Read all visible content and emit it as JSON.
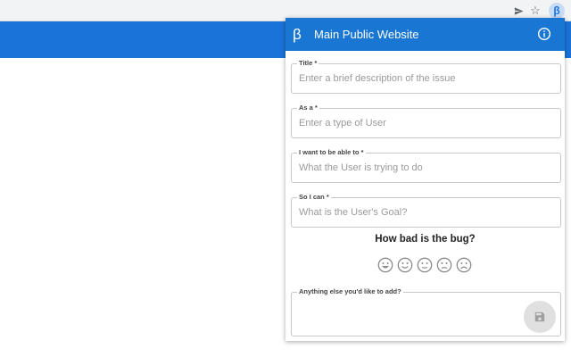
{
  "browser": {
    "send_icon": "send-icon",
    "star_icon": "star-icon",
    "extension_glyph": "β"
  },
  "popup": {
    "logo": "β",
    "title": "Main Public Website",
    "header_color": "#1976d2",
    "fields": [
      {
        "label": "Title *",
        "placeholder": "Enter a brief description of the issue"
      },
      {
        "label": "As a *",
        "placeholder": "Enter a type of User"
      },
      {
        "label": "I want to be able to *",
        "placeholder": "What the User is trying to do"
      },
      {
        "label": "So I can *",
        "placeholder": "What is the User's Goal?"
      }
    ],
    "rating_question": "How bad is the bug?",
    "rating_faces": [
      "very-happy-face-icon",
      "happy-face-icon",
      "neutral-face-icon",
      "slightly-sad-face-icon",
      "sad-face-icon"
    ],
    "extra": {
      "label": "Anything else you'd like to add?",
      "placeholder": ""
    },
    "save_icon": "save-icon"
  }
}
